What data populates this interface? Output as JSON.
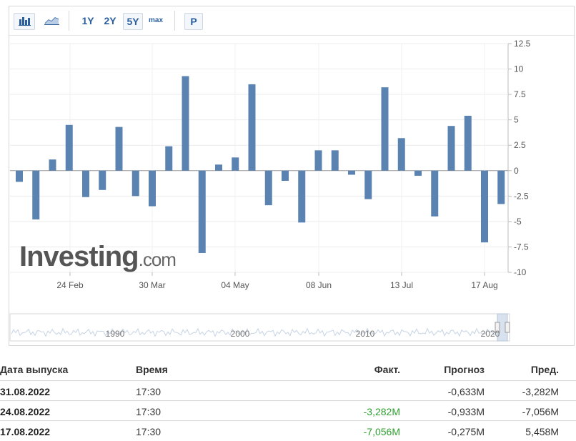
{
  "toolbar": {
    "bar_chart_icon": "bar-chart-icon",
    "line_chart_icon": "line-chart-icon",
    "ranges": [
      "1Y",
      "2Y",
      "5Y",
      "max"
    ],
    "active_range": "5Y",
    "p_label": "P"
  },
  "watermark": {
    "text": "Investing",
    "suffix": ".com"
  },
  "chart_data": {
    "type": "bar",
    "color": "#5b83b2",
    "ylim": [
      -10,
      12.5
    ],
    "y_ticks": [
      "12.5",
      "10",
      "7.5",
      "5",
      "2.5",
      "0",
      "-2.5",
      "-5",
      "-7.5",
      "-10"
    ],
    "x_tick_labels": [
      "24 Feb",
      "30 Mar",
      "04 May",
      "08 Jun",
      "13 Jul",
      "17 Aug"
    ],
    "values": [
      -1.1,
      -4.8,
      1.1,
      4.5,
      -2.6,
      -1.9,
      4.3,
      -2.5,
      -3.5,
      2.4,
      9.3,
      -8.1,
      0.6,
      1.3,
      8.5,
      -3.4,
      -1.0,
      -5.1,
      2.0,
      2.0,
      -0.4,
      -2.8,
      8.2,
      3.2,
      -0.5,
      -4.5,
      4.4,
      5.4,
      -7.056,
      -3.282
    ],
    "navigator_labels": [
      "1990",
      "2000",
      "2010",
      "2020"
    ]
  },
  "table": {
    "headers": {
      "date": "Дата выпуска",
      "time": "Время",
      "actual": "Факт.",
      "forecast": "Прогноз",
      "previous": "Пред."
    },
    "rows": [
      {
        "date": "31.08.2022",
        "time": "17:30",
        "actual": "",
        "forecast": "-0,633M",
        "previous": "-3,282M"
      },
      {
        "date": "24.08.2022",
        "time": "17:30",
        "actual": "-3,282M",
        "forecast": "-0,933M",
        "previous": "-7,056M"
      },
      {
        "date": "17.08.2022",
        "time": "17:30",
        "actual": "-7,056M",
        "forecast": "-0,275M",
        "previous": "5,458M"
      }
    ]
  }
}
